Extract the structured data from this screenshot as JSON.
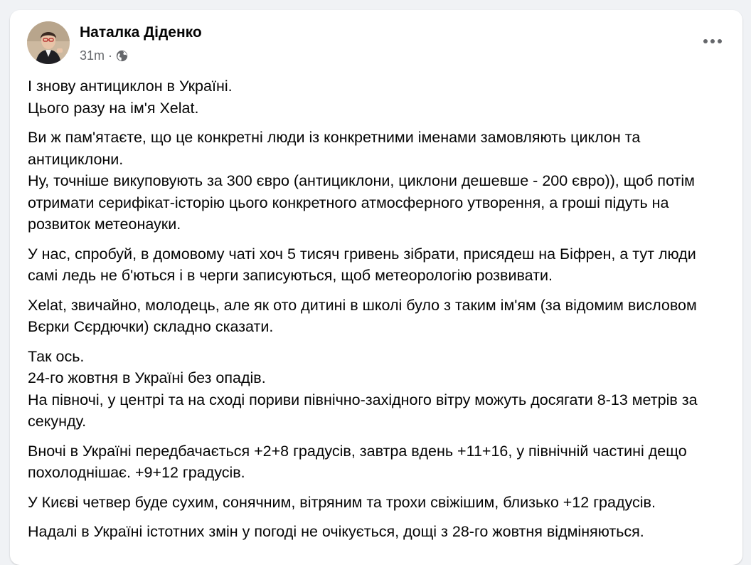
{
  "post": {
    "author_name": "Наталка Діденко",
    "timestamp": "31m",
    "separator": "·",
    "privacy_icon": "globe-icon",
    "more_icon": "more-options-icon",
    "paragraphs": [
      "І знову антициклон в Україні.\nЦього разу на ім'я Xelat.",
      "Ви ж пам'ятаєте, що це конкретні люди із конкретними іменами замовляють циклон та антициклони.\nНу, точніше викуповують за 300 євро (антициклони, циклони дешевше - 200 євро)), щоб потім отримати серифікат-історію цього конкретного атмосферного утворення, а гроші підуть на розвиток метеонауки.",
      "У нас, спробуй, в домовому чаті хоч 5 тисяч гривень зібрати, присядеш на Біфрен, а тут люди самі ледь не б'ються і в черги записуються, щоб метеорологію розвивати.",
      "Xelat, звичайно, молодець, але як ото дитині в школі було з таким ім'ям (за відомим висловом Вєрки Сєрдючки) складно сказати.",
      "Так ось.\n24-го жовтня в Україні без опадів.\nНа півночі, у центрі та на сході пориви північно-західного вітру можуть досягати 8-13 метрів за секунду.",
      "Вночі в Україні передбачається +2+8 градусів, завтра вдень +11+16, у північній частині дещо похолоднішає. +9+12 градусів.",
      "У Києві четвер буде сухим, сонячним, вітряним та трохи свіжішим, близько +12 градусів.",
      "Надалі в Україні істотних змін у погоді не очікується, дощі з 28-го жовтня відміняються."
    ]
  },
  "colors": {
    "page_background": "#f0f2f5",
    "card_background": "#ffffff",
    "primary_text": "#050505",
    "secondary_text": "#65676b"
  }
}
